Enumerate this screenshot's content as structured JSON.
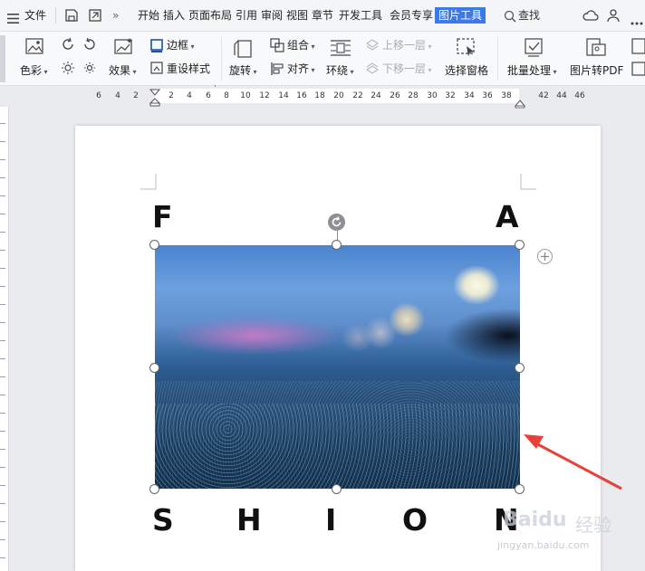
{
  "menubar": {
    "hamburger_icon": "menu-icon",
    "file": "文件",
    "tabs": [
      "开始",
      "插入",
      "页面布局",
      "引用",
      "审阅",
      "视图",
      "章节",
      "开发工具",
      "会员专享",
      "图片工具"
    ],
    "active_tab": "图片工具",
    "search": "查找",
    "accent_color": "#3b7ae8"
  },
  "ribbon": {
    "color": "色彩",
    "effects": "效果",
    "border": "边框",
    "reset_style": "重设样式",
    "rotate": "旋转",
    "group": "组合",
    "align": "对齐",
    "wrap": "环绕",
    "bring_forward": "上移一层",
    "send_backward": "下移一层",
    "selection_pane": "选择窗格",
    "batch_process": "批量处理",
    "image_to_pdf": "图片转PDF"
  },
  "ruler": {
    "numbers": [
      "6",
      "4",
      "2",
      "2",
      "4",
      "6",
      "8",
      "10",
      "12",
      "14",
      "16",
      "18",
      "20",
      "22",
      "24",
      "26",
      "28",
      "30",
      "32",
      "34",
      "36",
      "38",
      "42",
      "44",
      "46"
    ]
  },
  "document": {
    "letters_top": [
      "F",
      "A"
    ],
    "letters_bottom": [
      "S",
      "H",
      "I",
      "O",
      "N"
    ]
  },
  "watermark": {
    "brand": "Baidu",
    "brand_cn": "经验",
    "url": "jingyan.baidu.com"
  },
  "annotation_color": "#e8413a"
}
